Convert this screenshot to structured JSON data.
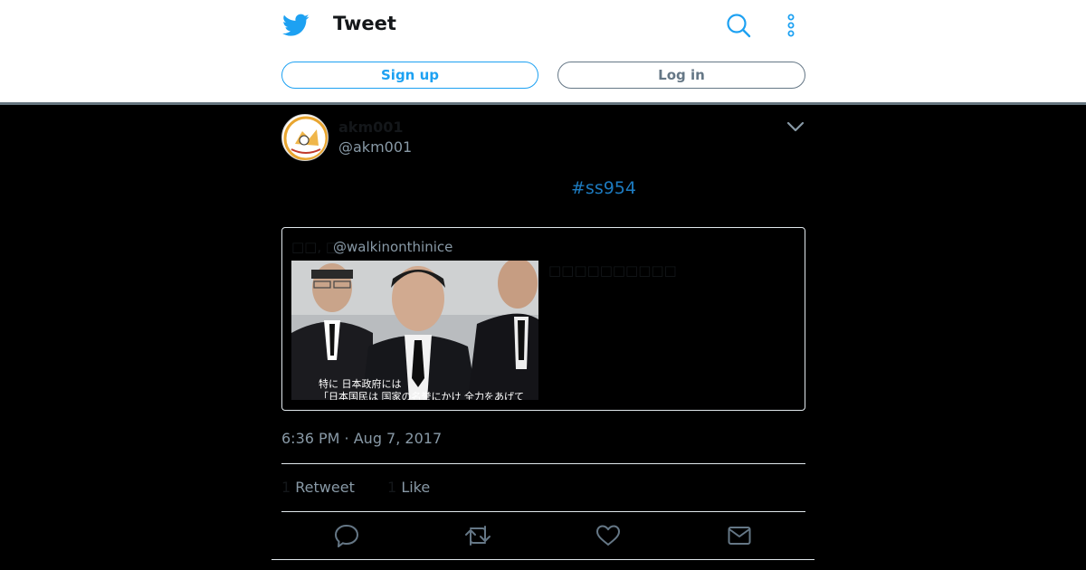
{
  "header": {
    "title": "Tweet"
  },
  "auth": {
    "signup_label": "Sign up",
    "login_label": "Log in"
  },
  "tweet": {
    "display_name": "akm001",
    "screen_name": "@akm001",
    "text": "#ss954",
    "timestamp": "6:36 PM · Aug 7, 2017",
    "retweets_count": "1",
    "retweets_label": "Retweet",
    "likes_count": "1",
    "likes_label": "Like"
  },
  "quoted_tweet": {
    "display_name": "□□, □",
    "screen_name": "@walkinonthinice",
    "text": "□□□□□□□□□□",
    "photo_caption_line1": "特に 日本政府には",
    "photo_caption_line2": "「日本国民は 国家の名誉にかけ 全力をあげて"
  },
  "colors": {
    "accent": "#1da1f2",
    "hashtag": "#1d7bc0",
    "secondary_text": "#8899a6",
    "background": "#000000"
  },
  "icons": [
    "twitter-bird-icon",
    "search-icon",
    "more-icon",
    "chevron-down-icon",
    "reply-icon",
    "retweet-icon",
    "like-icon",
    "share-icon"
  ]
}
